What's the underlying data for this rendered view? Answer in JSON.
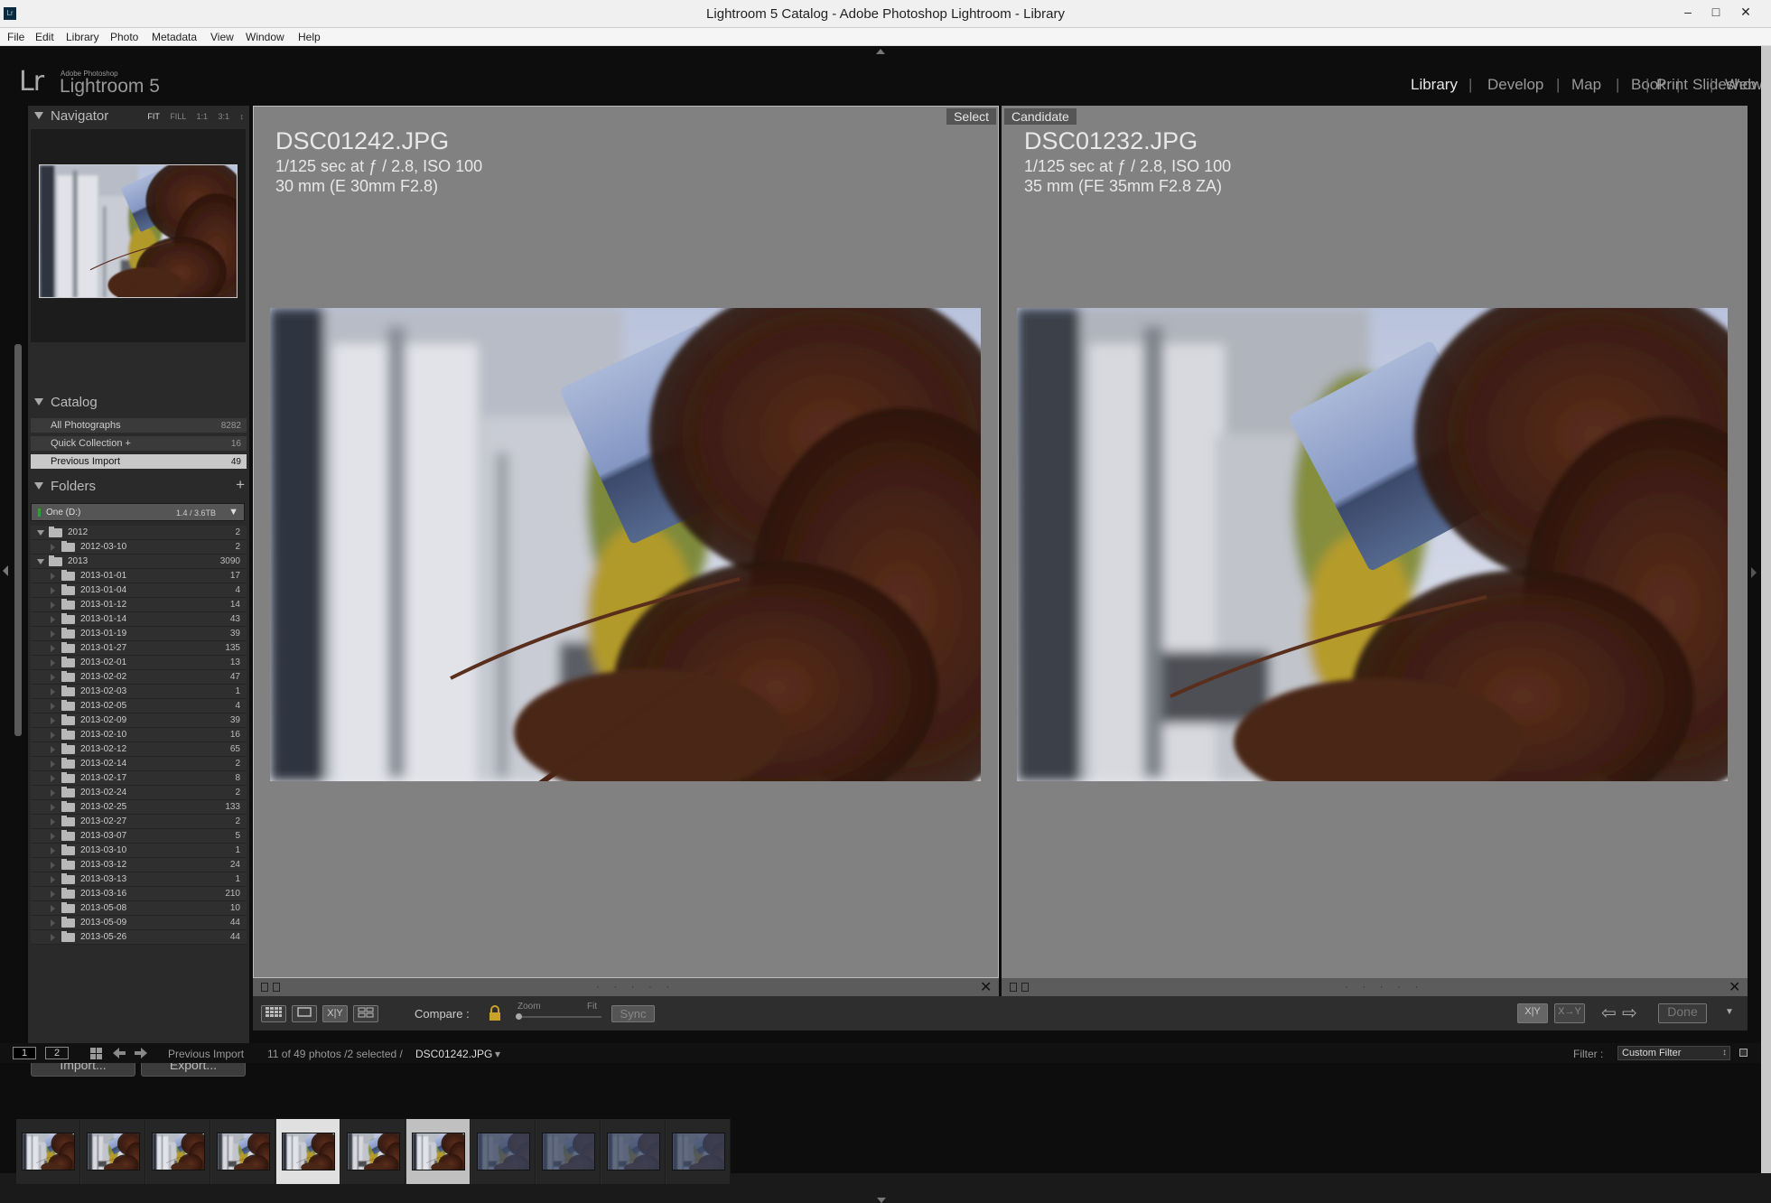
{
  "window": {
    "title": "Lightroom 5 Catalog - Adobe Photoshop Lightroom - Library",
    "app_icon": "Lr",
    "minimize": "–",
    "maximize": "□",
    "close": "✕"
  },
  "menu": [
    "File",
    "Edit",
    "Library",
    "Photo",
    "Metadata",
    "View",
    "Window",
    "Help"
  ],
  "brand": {
    "logo": "Lr",
    "small": "Adobe Photoshop",
    "name": "Lightroom 5"
  },
  "modules": {
    "items": [
      "Library",
      "Develop",
      "Map",
      "Book",
      "Slideshow",
      "Print",
      "Web"
    ],
    "active": "Library",
    "separator": "|"
  },
  "navigator": {
    "label": "Navigator",
    "options": [
      "FIT",
      "FILL",
      "1:1",
      "3:1"
    ],
    "active_option": "FIT",
    "stepper": "↕"
  },
  "catalog": {
    "label": "Catalog",
    "items": [
      {
        "label": "All Photographs",
        "count": "8282"
      },
      {
        "label": "Quick Collection +",
        "count": "16"
      },
      {
        "label": "Previous Import",
        "count": "49"
      }
    ],
    "selected": "Previous Import"
  },
  "folders": {
    "label": "Folders",
    "add": "+",
    "volume": {
      "name": "One (D:)",
      "size": "1.4 / 3.6TB",
      "menu": "▼"
    },
    "items": [
      {
        "name": "2012",
        "count": "2",
        "level": 0,
        "open": true
      },
      {
        "name": "2012-03-10",
        "count": "2",
        "level": 1
      },
      {
        "name": "2013",
        "count": "3090",
        "level": 0,
        "open": true
      },
      {
        "name": "2013-01-01",
        "count": "17",
        "level": 1
      },
      {
        "name": "2013-01-04",
        "count": "4",
        "level": 1
      },
      {
        "name": "2013-01-12",
        "count": "14",
        "level": 1
      },
      {
        "name": "2013-01-14",
        "count": "43",
        "level": 1
      },
      {
        "name": "2013-01-19",
        "count": "39",
        "level": 1
      },
      {
        "name": "2013-01-27",
        "count": "135",
        "level": 1
      },
      {
        "name": "2013-02-01",
        "count": "13",
        "level": 1
      },
      {
        "name": "2013-02-02",
        "count": "47",
        "level": 1
      },
      {
        "name": "2013-02-03",
        "count": "1",
        "level": 1
      },
      {
        "name": "2013-02-05",
        "count": "4",
        "level": 1
      },
      {
        "name": "2013-02-09",
        "count": "39",
        "level": 1
      },
      {
        "name": "2013-02-10",
        "count": "16",
        "level": 1
      },
      {
        "name": "2013-02-12",
        "count": "65",
        "level": 1
      },
      {
        "name": "2013-02-14",
        "count": "2",
        "level": 1
      },
      {
        "name": "2013-02-17",
        "count": "8",
        "level": 1
      },
      {
        "name": "2013-02-24",
        "count": "2",
        "level": 1
      },
      {
        "name": "2013-02-25",
        "count": "133",
        "level": 1
      },
      {
        "name": "2013-02-27",
        "count": "2",
        "level": 1
      },
      {
        "name": "2013-03-07",
        "count": "5",
        "level": 1
      },
      {
        "name": "2013-03-10",
        "count": "1",
        "level": 1
      },
      {
        "name": "2013-03-12",
        "count": "24",
        "level": 1
      },
      {
        "name": "2013-03-13",
        "count": "1",
        "level": 1
      },
      {
        "name": "2013-03-16",
        "count": "210",
        "level": 1
      },
      {
        "name": "2013-05-08",
        "count": "10",
        "level": 1
      },
      {
        "name": "2013-05-09",
        "count": "44",
        "level": 1
      },
      {
        "name": "2013-05-26",
        "count": "44",
        "level": 1
      }
    ]
  },
  "left_buttons": {
    "import": "Import...",
    "export": "Export..."
  },
  "compare": {
    "select": {
      "tag": "Select",
      "filename": "DSC01242.JPG",
      "exposure": "1/125 sec at ƒ / 2.8, ISO 100",
      "lens": "30 mm (E 30mm F2.8)",
      "dots": "· · · · ·"
    },
    "candidate": {
      "tag": "Candidate",
      "filename": "DSC01232.JPG",
      "exposure": "1/125 sec at ƒ / 2.8, ISO 100",
      "lens": "35 mm (FE 35mm F2.8 ZA)",
      "dots": "· · · · ·"
    },
    "close": "✕"
  },
  "toolbar": {
    "grid_icon": "grid-view-icon",
    "loupe_icon": "loupe-view-icon",
    "compare_icon": "X|Y",
    "survey_icon": "survey-view-icon",
    "compare_label": "Compare :",
    "zoom_label": "Zoom",
    "fit_label": "Fit",
    "sync": "Sync",
    "swap": "X|Y",
    "make_select": "X→Y",
    "prev": "⇦",
    "next": "⇨",
    "done": "Done",
    "menu": "▼"
  },
  "filmbar": {
    "screen1": "1",
    "screen2": "2",
    "source": "Previous Import",
    "count": "11 of 49 photos /2 selected /",
    "current": "DSC01242.JPG",
    "current_menu": "▾",
    "filter_label": "Filter :",
    "filter_value": "Custom Filter",
    "filter_arrows": "↕"
  },
  "filmstrip": {
    "count": 11,
    "selected_indices": [
      4,
      6
    ],
    "active_index": 4
  }
}
